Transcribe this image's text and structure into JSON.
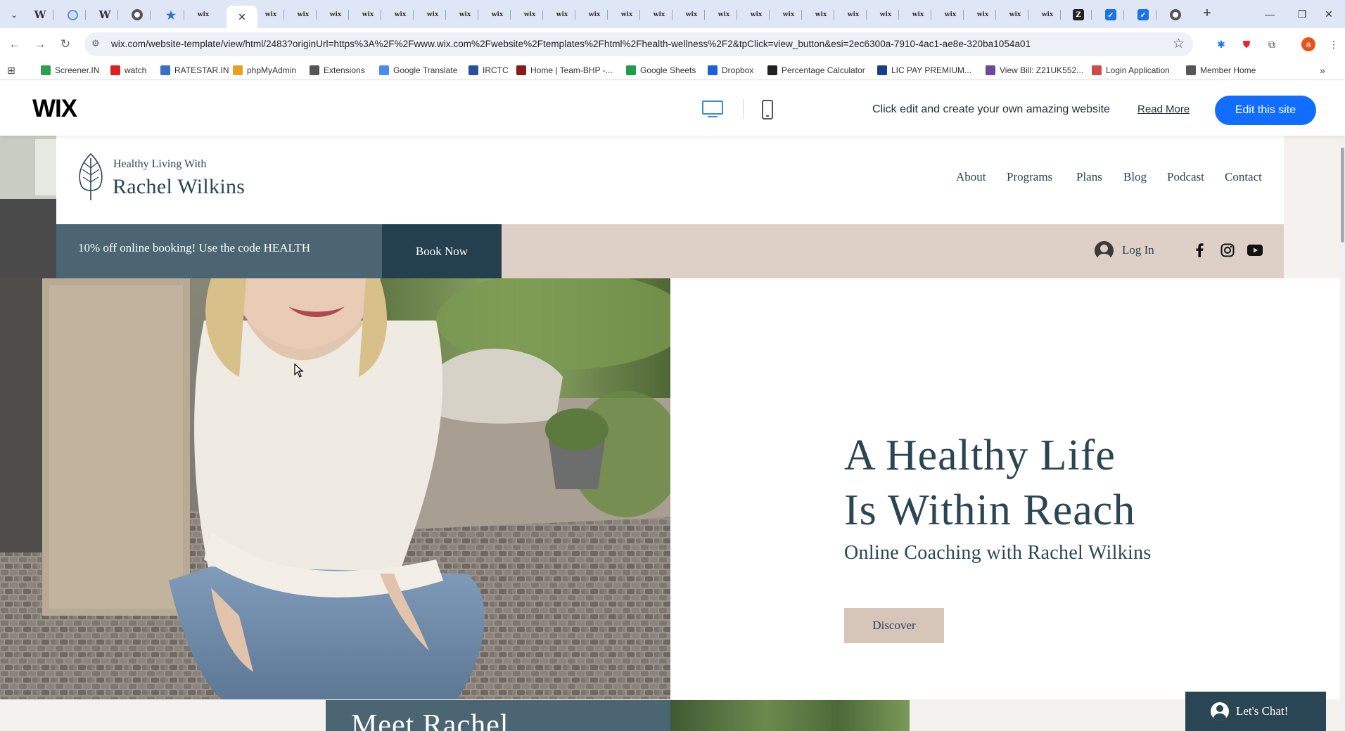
{
  "browser": {
    "address_url": "wix.com/website-template/view/html/2483?originUrl=https%3A%2F%2Fwww.wix.com%2Fwebsite%2Ftemplates%2Fhtml%2Fhealth-wellness%2F2&tpClick=view_button&esi=2ec6300a-7910-4ac1-ae8e-320ba1054a01",
    "tab_favicon_text": "wix",
    "wiki_glyph": "W",
    "profile_initial": "a",
    "bookmarks": [
      {
        "label": "Screener.IN",
        "color": "#2e9e4f"
      },
      {
        "label": "watch",
        "color": "#e02020"
      },
      {
        "label": "RATESTAR.IN",
        "color": "#3a6fc4"
      },
      {
        "label": "phpMyAdmin",
        "color": "#e8a020"
      },
      {
        "label": "Extensions",
        "color": "#555555"
      },
      {
        "label": "Google Translate",
        "color": "#4a8af4"
      },
      {
        "label": "IRCTC",
        "color": "#2a4f9a"
      },
      {
        "label": "Home | Team-BHP -...",
        "color": "#8a1a1a"
      },
      {
        "label": "Google Sheets",
        "color": "#1e9e4a"
      },
      {
        "label": "Dropbox",
        "color": "#1a62d8"
      },
      {
        "label": "Percentage Calculator",
        "color": "#222222"
      },
      {
        "label": "LIC PAY PREMIUM...",
        "color": "#1a3f8a"
      },
      {
        "label": "View Bill: Z21UK552...",
        "color": "#6a4aa0"
      },
      {
        "label": "Login Application",
        "color": "#d04a4a"
      },
      {
        "label": "Member Home",
        "color": "#555555"
      }
    ]
  },
  "wix_bar": {
    "logo": "WIX",
    "promo_text": "Click edit and create your own amazing website",
    "read_more": "Read More",
    "edit_button": "Edit this site"
  },
  "site": {
    "brand_small": "Healthy Living With",
    "brand_large": "Rachel Wilkins",
    "nav": [
      "About",
      "Programs",
      "Plans",
      "Blog",
      "Podcast",
      "Contact"
    ],
    "promo_text": "10% off online booking! Use the code HEALTH",
    "book_button": "Book Now",
    "login_label": "Log In",
    "hero_title_line1": "A Healthy Life",
    "hero_title_line2": "Is Within Reach",
    "hero_subtitle": "Online Coaching with Rachel Wilkins",
    "discover_button": "Discover",
    "meet_heading": "Meet Rachel",
    "chat_label": "Let's Chat!"
  },
  "colors": {
    "brand_dark": "#2a4554",
    "promo_dark": "#4b6573",
    "book_btn": "#243f4d",
    "promo_beige": "#ded0c7",
    "discover_bg": "#d6c5b9",
    "wix_blue": "#116dff"
  }
}
